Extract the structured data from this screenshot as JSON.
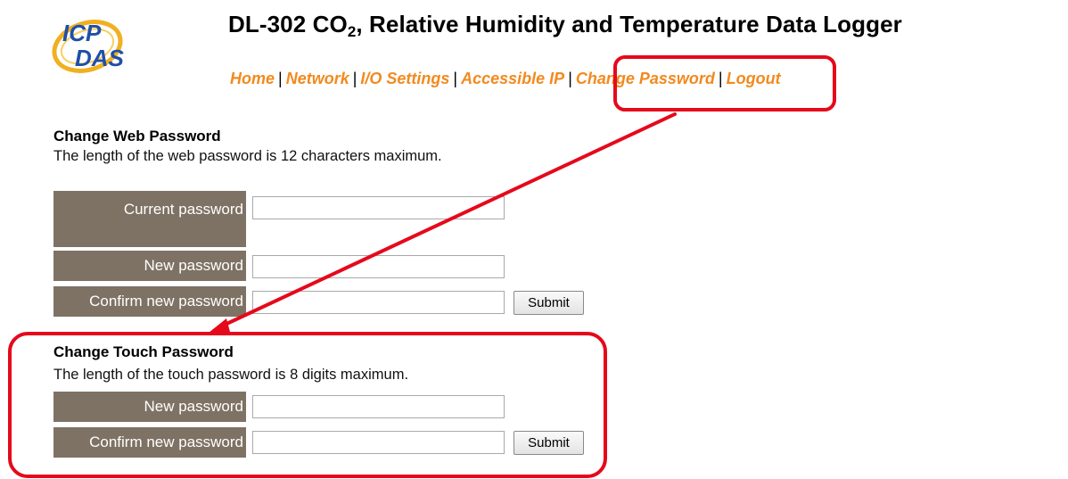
{
  "header": {
    "title_main": "DL-302 CO",
    "title_sub": "2",
    "title_rest": ", Relative Humidity and Temperature Data Logger",
    "logo_text_top": "ICP",
    "logo_text_bottom": "DAS"
  },
  "nav": {
    "items": [
      {
        "label": "Home"
      },
      {
        "label": "Network"
      },
      {
        "label": "I/O Settings"
      },
      {
        "label": "Accessible IP"
      },
      {
        "label": "Change Password"
      },
      {
        "label": "Logout"
      }
    ],
    "separator": "|"
  },
  "web_password": {
    "title": "Change Web Password",
    "description": "The length of the web password is 12 characters maximum.",
    "current_label": "Current password",
    "current_value": "",
    "new_label": "New password",
    "new_value": "",
    "confirm_label": "Confirm new password",
    "confirm_value": "",
    "submit_label": "Submit"
  },
  "touch_password": {
    "title": "Change Touch Password",
    "description": "The length of the touch password is 8 digits maximum.",
    "new_label": "New password",
    "new_value": "",
    "confirm_label": "Confirm new password",
    "confirm_value": "",
    "submit_label": "Submit"
  },
  "colors": {
    "nav_link": "#f28a1e",
    "label_bg": "#7e7264",
    "annotation": "#e5091b"
  }
}
